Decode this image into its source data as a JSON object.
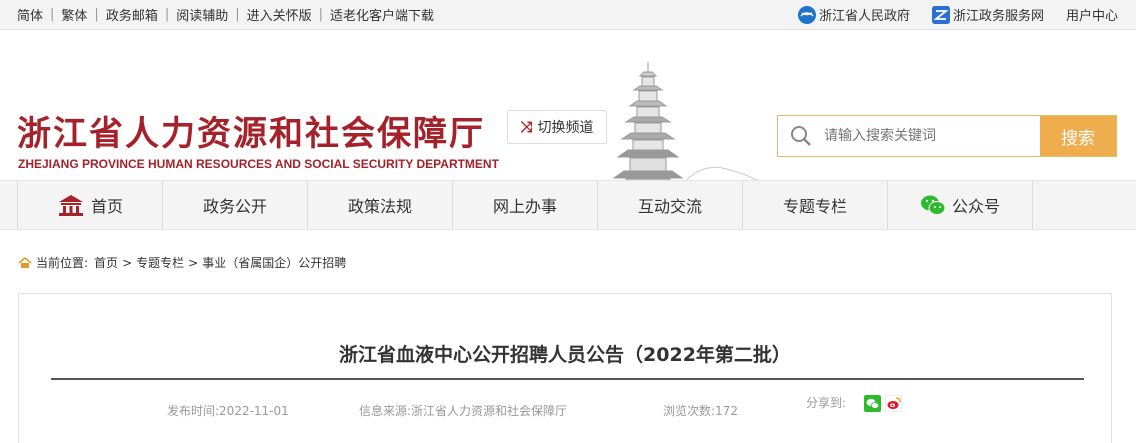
{
  "topbar": {
    "links": [
      "简体",
      "繁体",
      "政务邮箱",
      "阅读辅助",
      "进入关怀版",
      "适老化客户端下载"
    ],
    "gov_link": "浙江省人民政府",
    "service_link": "浙江政务服务网",
    "user_center": "用户中心"
  },
  "header": {
    "logo_cn": "浙江省人力资源和社会保障厅",
    "logo_en": "ZHEJIANG PROVINCE HUMAN RESOURCES AND SOCIAL SECURITY DEPARTMENT",
    "switch_label": "切换频道",
    "search_placeholder": "请输入搜索关键词",
    "search_button": "搜索"
  },
  "nav": {
    "items": [
      "首页",
      "政务公开",
      "政策法规",
      "网上办事",
      "互动交流",
      "专题专栏",
      "公众号"
    ]
  },
  "breadcrumb": {
    "label": "当前位置:",
    "items": [
      "首页",
      "专题专栏",
      "事业（省属国企）公开招聘"
    ]
  },
  "article": {
    "title": "浙江省血液中心公开招聘人员公告（2022年第二批）",
    "publish_time": "发布时间:2022-11-01",
    "source": "信息来源:浙江省人力资源和社会保障厅",
    "views": "浏览次数:172",
    "share_label": "分享到:"
  },
  "colors": {
    "brand_red": "#a5222a",
    "search_orange": "#efad4e",
    "wechat_green": "#2dbb2d",
    "weibo_red": "#e6162d"
  }
}
